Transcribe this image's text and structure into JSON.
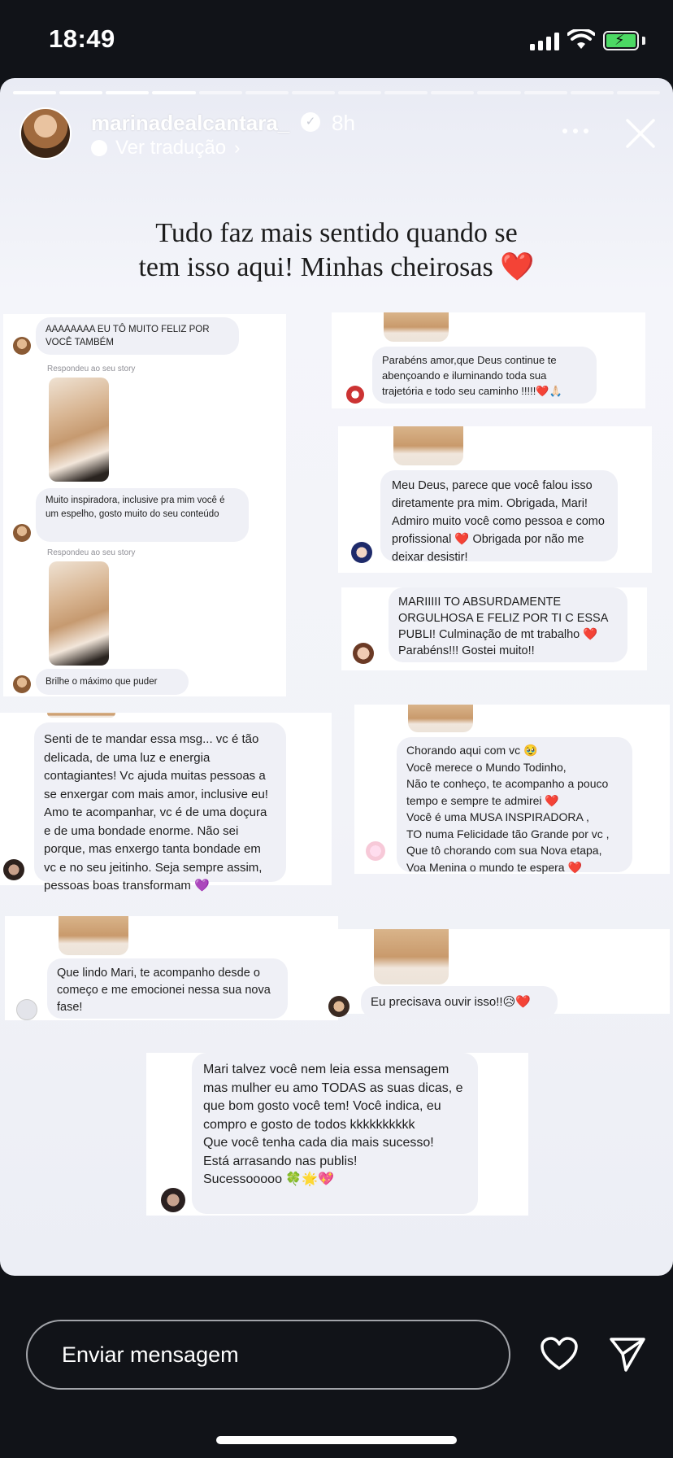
{
  "status_bar": {
    "time": "18:49"
  },
  "story": {
    "username": "marinadealcantara_",
    "posted_ago": "8h",
    "translate_label": "Ver tradução",
    "caption_line1": "Tudo faz mais sentido quando se",
    "caption_line2": "tem isso aqui! Minhas cheirosas",
    "caption_emoji": "❤️",
    "progress_segments_total": 14,
    "progress_segments_done": 4
  },
  "messages": {
    "m1": "AAAAAAAA EU TÔ MUITO FELIZ POR VOCÊ TAMBÉM",
    "replied_1": "Respondeu ao seu story",
    "m2": "Muito inspiradora, inclusive pra mim você é um espelho, gosto muito do seu conteúdo",
    "replied_2": "Respondeu ao seu story",
    "m3": "Brilhe o máximo que puder",
    "m4": "Parabéns amor,que Deus continue te abençoando e iluminando toda sua trajetória e todo seu caminho !!!!!❤️🙏🏻",
    "m5": "Meu Deus, parece que você falou isso diretamente pra mim. Obrigada, Mari! Admiro muito você como pessoa e como profissional ❤️ Obrigada por não me deixar desistir!",
    "m6": "MARIIIII TO ABSURDAMENTE ORGULHOSA E FELIZ POR TI C ESSA PUBLI! Culminação de mt trabalho ❤️ Parabéns!!! Gostei muito!!",
    "m7": "Senti de te mandar essa msg... vc é tão delicada, de uma luz e energia contagiantes! Vc ajuda muitas pessoas a se enxergar com mais amor, inclusive eu! Amo te acompanhar, vc é de uma doçura e de uma bondade enorme. Não sei porque, mas enxergo tanta bondade em vc e no seu jeitinho. Seja sempre assim, pessoas boas transformam 💜",
    "m8_lines": [
      "Chorando aqui com vc 🥹",
      "Você merece o Mundo Todinho,",
      "Não te conheço, te acompanho a pouco tempo e sempre te admirei ❤️",
      "Você é uma MUSA INSPIRADORA ,",
      "TO numa Felicidade tão Grande por vc ,",
      "Que tô chorando com sua Nova etapa,",
      "Voa Menina o mundo te espera ❤️"
    ],
    "m9": "Que lindo Mari, te acompanho desde o começo e me emocionei nessa sua nova fase!",
    "m10": "Eu precisava ouvir isso!!😥❤️",
    "m11_lines": [
      "Mari talvez você nem leia essa mensagem mas mulher eu amo TODAS as suas dicas, e que bom gosto você tem! Você indica, eu compro e gosto de todos kkkkkkkkkk",
      "Que você tenha cada dia mais sucesso!",
      "Está arrasando nas publis!",
      "Sucessooooo 🍀🌟💖"
    ]
  },
  "reply_bar": {
    "placeholder": "Enviar mensagem"
  },
  "icons": [
    "signal-icon",
    "wifi-icon",
    "battery-icon",
    "verified-icon",
    "more-icon",
    "close-icon",
    "heart-icon",
    "send-icon"
  ],
  "colors": {
    "heart": "#e0283a",
    "battery": "#4cd964",
    "bubble": "#eff0f6"
  }
}
